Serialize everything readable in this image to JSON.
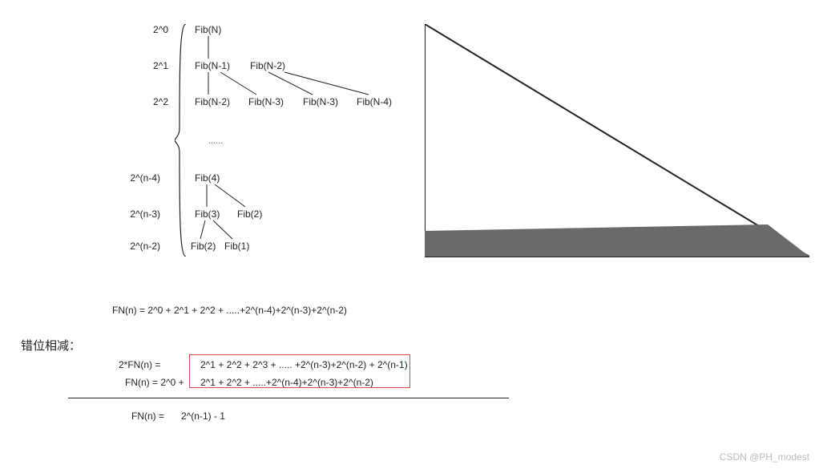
{
  "rows": {
    "r0_label": "2^0",
    "r1_label": "2^1",
    "r2_label": "2^2",
    "r3_label": "2^(n-4)",
    "r4_label": "2^(n-3)",
    "r5_label": "2^(n-2)"
  },
  "nodes": {
    "n0": "Fib(N)",
    "n1a": "Fib(N-1)",
    "n1b": "Fib(N-2)",
    "n2a": "Fib(N-2)",
    "n2b": "Fib(N-3)",
    "n2c": "Fib(N-3)",
    "n2d": "Fib(N-4)",
    "n3a": "Fib(4)",
    "n4a": "Fib(3)",
    "n4b": "Fib(2)",
    "n5a": "Fib(2)",
    "n5b": "Fib(1)"
  },
  "ellipsis": "......",
  "equations": {
    "fn_sum": "FN(n) = 2^0 + 2^1 + 2^2 + .....+2^(n-4)+2^(n-3)+2^(n-2)",
    "section_title": "错位相减：",
    "line1_left": "2*FN(n) =",
    "line1_right": "2^1 + 2^2 + 2^3 + .....   +2^(n-3)+2^(n-2) + 2^(n-1)",
    "line2_left": "FN(n) = 2^0 +",
    "line2_right": "2^1 + 2^2 + .....+2^(n-4)+2^(n-3)+2^(n-2)",
    "result_left": "FN(n) =",
    "result_right": "2^(n-1) - 1"
  },
  "watermark": "CSDN @PH_modest",
  "chart_data": {
    "type": "diagram",
    "description": "Fibonacci recursion tree showing exponential node count per level, plus triangle illustration and telescoping subtraction proof",
    "levels": [
      {
        "k": 0,
        "count_expr": "2^0",
        "nodes": [
          "Fib(N)"
        ]
      },
      {
        "k": 1,
        "count_expr": "2^1",
        "nodes": [
          "Fib(N-1)",
          "Fib(N-2)"
        ]
      },
      {
        "k": 2,
        "count_expr": "2^2",
        "nodes": [
          "Fib(N-2)",
          "Fib(N-3)",
          "Fib(N-3)",
          "Fib(N-4)"
        ]
      },
      {
        "k": "n-4",
        "count_expr": "2^(n-4)",
        "nodes": [
          "Fib(4)"
        ]
      },
      {
        "k": "n-3",
        "count_expr": "2^(n-3)",
        "nodes": [
          "Fib(3)",
          "Fib(2)"
        ]
      },
      {
        "k": "n-2",
        "count_expr": "2^(n-2)",
        "nodes": [
          "Fib(2)",
          "Fib(1)"
        ]
      }
    ],
    "sum_formula": "FN(n) = 2^0 + 2^1 + 2^2 + ... + 2^(n-2)",
    "closed_form": "FN(n) = 2^(n-1) - 1"
  }
}
